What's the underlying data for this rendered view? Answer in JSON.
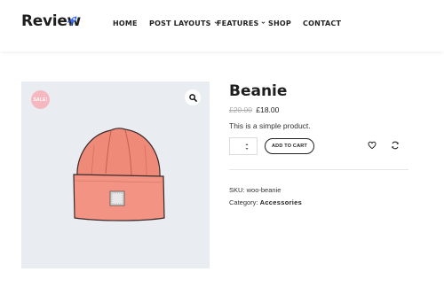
{
  "header": {
    "logo_text": "Review",
    "nav": [
      {
        "label": "HOME",
        "has_dropdown": false
      },
      {
        "label": "POST LAYOUTS",
        "has_dropdown": true
      },
      {
        "label": "FEATURES",
        "has_dropdown": true
      },
      {
        "label": "SHOP",
        "has_dropdown": false
      },
      {
        "label": "CONTACT",
        "has_dropdown": false
      }
    ]
  },
  "product": {
    "sale_badge": "SALE!",
    "image_subject": "beanie-hat",
    "title": "Beanie",
    "old_price": "£20.00",
    "price": "£18.00",
    "short_description": "This is a simple product.",
    "add_to_cart_label": "ADD TO CART",
    "sku_label": "SKU:",
    "sku_value": "woo-beanie",
    "category_label": "Category:",
    "category_value": "Accessories"
  },
  "colors": {
    "accent_rocket": "#3b6cf5",
    "sale_badge": "#f6b8c0",
    "beanie": "#f08a78",
    "image_background": "#e9edf1"
  }
}
